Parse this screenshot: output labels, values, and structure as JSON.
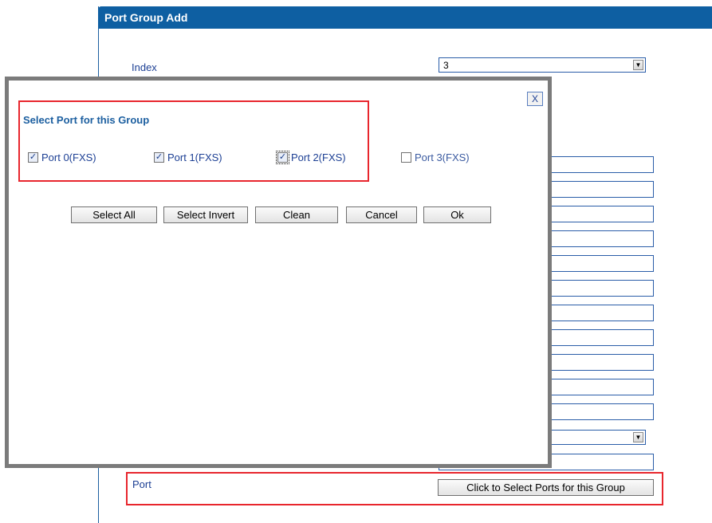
{
  "panel": {
    "title": "Port Group Add",
    "index_label": "Index",
    "index_value": "3",
    "port_label": "Port",
    "select_ports_button": "Click to Select Ports for this Group"
  },
  "dialog": {
    "close_label": "X",
    "title": "Select Port for this Group",
    "ports": [
      {
        "label": "Port 0(FXS)",
        "checked": true
      },
      {
        "label": "Port 1(FXS)",
        "checked": true
      },
      {
        "label": "Port 2(FXS)",
        "checked": true
      },
      {
        "label": "Port 3(FXS)",
        "checked": false
      }
    ],
    "buttons": {
      "select_all": "Select All",
      "select_invert": "Select Invert",
      "clean": "Clean",
      "cancel": "Cancel",
      "ok": "Ok"
    }
  },
  "colors": {
    "header": "#0e5fa2",
    "highlight": "#e8262d",
    "label": "#1c3f94"
  }
}
